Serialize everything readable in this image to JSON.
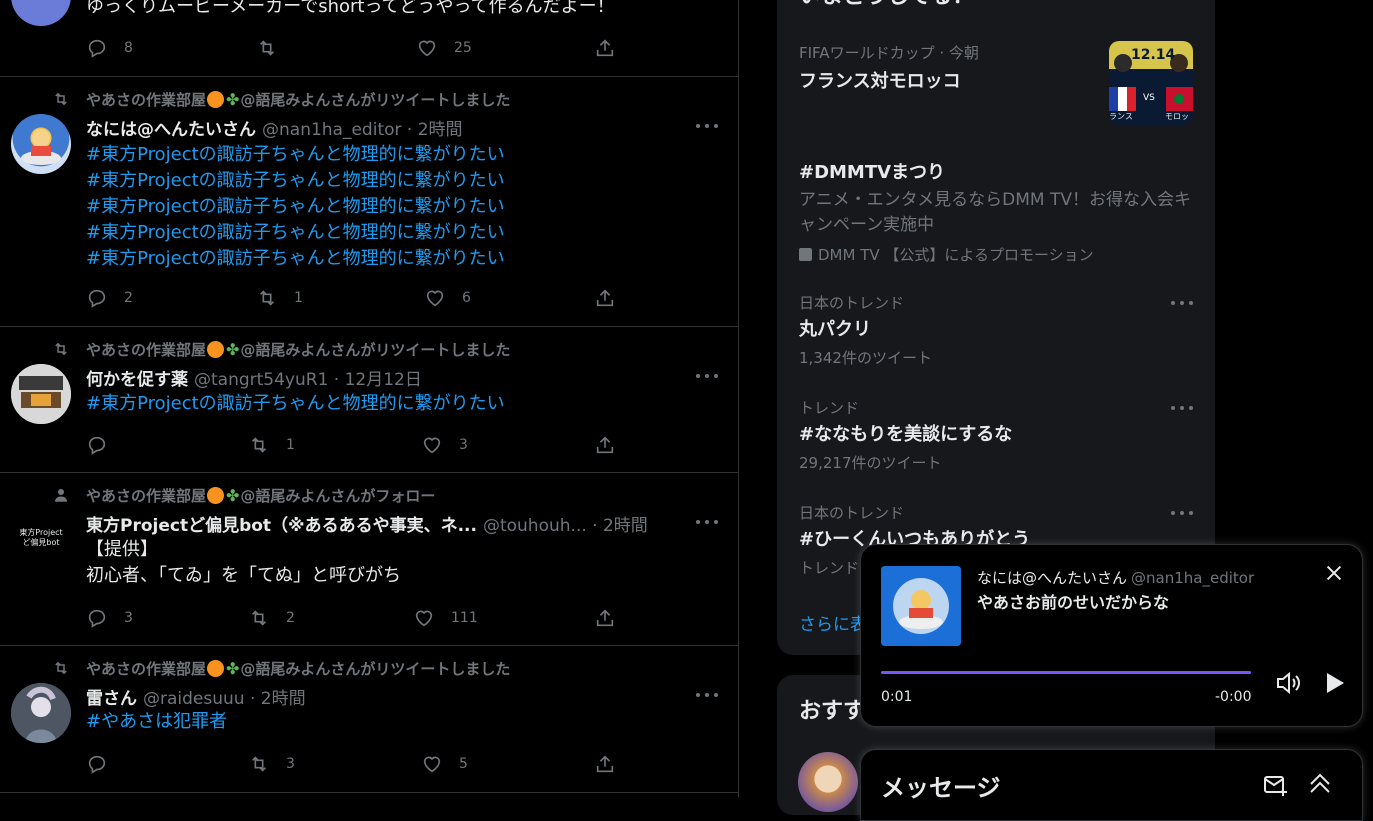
{
  "timeline": {
    "top_partial": {
      "text": "ゆっくりムービーメーカーでshortってどうやって作るんだよー！",
      "replies": "8",
      "likes": "25"
    },
    "tweets": [
      {
        "context_prefix": "やあさの作業部屋",
        "context_suffix": "@語尾みよんさんがリツイートしました",
        "name": "なには@へんたいさん",
        "handle": "@nan1ha_editor · 2時間",
        "lines": [
          "#東方Projectの諏訪子ちゃんと物理的に繋がりたい",
          "#東方Projectの諏訪子ちゃんと物理的に繋がりたい",
          "#東方Projectの諏訪子ちゃんと物理的に繋がりたい",
          "#東方Projectの諏訪子ちゃんと物理的に繋がりたい",
          "#東方Projectの諏訪子ちゃんと物理的に繋がりたい"
        ],
        "replies": "2",
        "retweets": "1",
        "likes": "6"
      },
      {
        "context_prefix": "やあさの作業部屋",
        "context_suffix": "@語尾みよんさんがリツイートしました",
        "name": "何かを促す薬",
        "handle": "@tangrt54yuR1 · 12月12日",
        "lines": [
          "#東方Projectの諏訪子ちゃんと物理的に繋がりたい"
        ],
        "replies": "",
        "retweets": "1",
        "likes": "3"
      },
      {
        "context_prefix": "やあさの作業部屋",
        "context_suffix": "@語尾みよんさんがフォロー",
        "name": "東方Projectど偏見bot（※あるあるや事実、ネ...",
        "handle": "@touhouh... · 2時間",
        "avatar_text": "東方Projectど偏見bot",
        "lines": [
          "【提供】",
          "初心者、「てゐ」を「てぬ」と呼びがち"
        ],
        "replies": "3",
        "retweets": "2",
        "likes": "111"
      },
      {
        "context_prefix": "やあさの作業部屋",
        "context_suffix": "@語尾みよんさんがリツイートしました",
        "name": "雷さん",
        "handle": "@raidesuuu · 2時間",
        "lines": [
          "#やあさは犯罪者"
        ],
        "replies": "",
        "retweets": "3",
        "likes": "5"
      }
    ]
  },
  "sidebar": {
    "title": "いまどうしてる？",
    "trends": [
      {
        "category": "FIFAワールドカップ · 今朝",
        "name": "フランス対モロッコ",
        "image_date": "12.14",
        "image_vs": "VS",
        "image_left": "ランス",
        "image_right": "モロッ"
      },
      {
        "category": "",
        "name": "#DMMTVまつり",
        "desc": "アニメ・エンタメ見るならDMM TV！お得な入会キャンペーン実施中",
        "promo": "DMM TV 【公式】によるプロモーション"
      },
      {
        "category": "日本のトレンド",
        "name": "丸パクリ",
        "count": "1,342件のツイート"
      },
      {
        "category": "トレンド",
        "name": "#ななもりを美談にするな",
        "count": "29,217件のツイート"
      },
      {
        "category": "日本のトレンド",
        "name": "#ひーくんいつもありがとう",
        "count": "トレンド"
      }
    ],
    "show_more": "さらに表",
    "section2_title": "おすす"
  },
  "player": {
    "name": "なには@へんたいさん",
    "handle": "@nan1ha_editor",
    "text": "やあさお前のせいだからな",
    "time_current": "0:01",
    "time_remaining": "-0:00"
  },
  "drawer": {
    "title": "メッセージ"
  },
  "colors": {
    "accent": "#1d9bf0",
    "muted": "#71767b",
    "progress": "#7856ff",
    "background": "#000000"
  }
}
